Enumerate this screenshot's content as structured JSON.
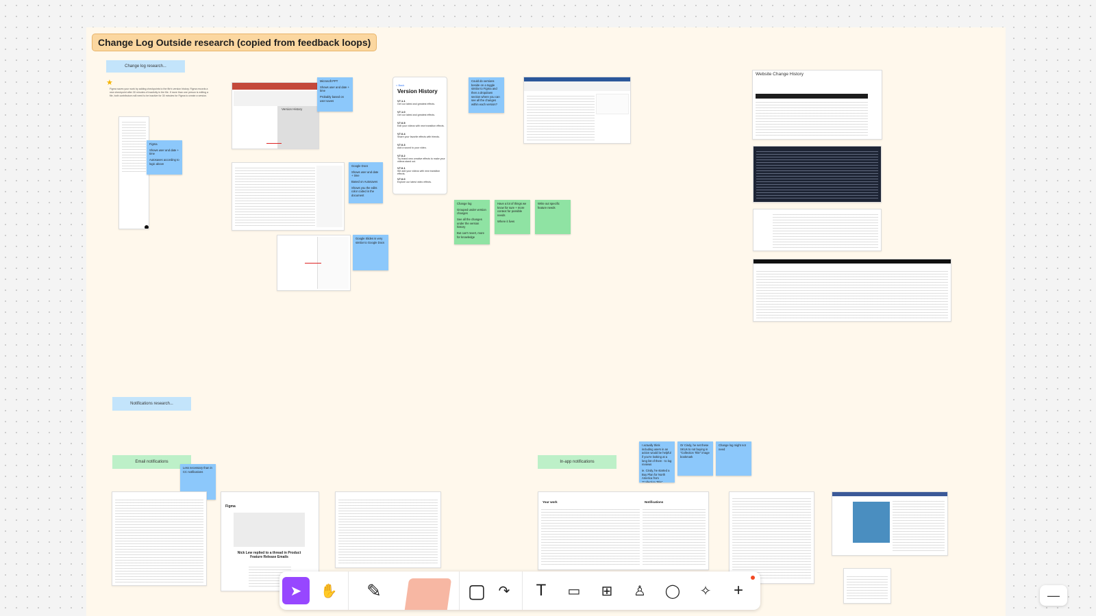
{
  "section": {
    "title": "Change Log Outside research (copied from feedback loops)"
  },
  "labels": {
    "change_log": "Change log research...",
    "notifications": "Notifications research...",
    "email": "Email notifications",
    "inapp": "In-app notifications"
  },
  "figma_note": "Figma saves your work by adding checkpoints to the file's version history. Figma records a new checkpoint after 30 minutes of inactivity in the file. If more than one person is editing a file, both contributors will need to be inactive for 30 minutes for Figma to create a version.",
  "stickies": {
    "microsoft": [
      "Microsoft PPT",
      "Shows user and date + time",
      "Probably based on user saves"
    ],
    "figma": [
      "Figma",
      "Shows user and date + time",
      "Autosaves according to logic above"
    ],
    "google_docs": [
      "Google Docs",
      "Shows user and date + time",
      "Based on Autosaves",
      "Shows you the edits color coded in the document"
    ],
    "google_slides": [
      "Google Slides is very similar to Google Docs"
    ],
    "versions_beside": [
      "Could do versions beside on a toggle similar to Figma and then a dropdown section where you can see all the changes within each version?"
    ],
    "change_log_green": [
      "Change log",
      "Grouped under version changes",
      "See all the changes under the version history",
      "But can't revert, more for knowledge"
    ],
    "tags_green": [
      "Have a lot of things we know for sure + more context for possible needs",
      "Where it lives"
    ],
    "feature_green": [
      "Write out specific feature needs"
    ],
    "less_necessary": [
      "Less necessary than in CC notifications"
    ],
    "inapp_1": [
      "I actually think including users in an action would be helpful if you're looking at a long list of them - to log reviews",
      "ie. Cindy, he started a Buy Plan for North America from \"Collection Title\""
    ],
    "inapp_2": [
      "Or Cindy, he set these SKUs to not buying in \"Collection Title\" image bookmark"
    ],
    "inapp_3": [
      "Change log might not need"
    ]
  },
  "version_history": {
    "title": "Version History",
    "back": "< Back",
    "entries": [
      {
        "version": "V7.1.1",
        "text": "Get our latest and greatest effects."
      },
      {
        "version": "V7.1.0",
        "text": "Get our latest and greatest effects."
      },
      {
        "version": "V7.0.5",
        "text": "Edit your videos with new transition effects."
      },
      {
        "version": "V7.0.4",
        "text": "Share your favorite effects with friends."
      },
      {
        "version": "V7.0.3",
        "text": "Add a sound to your video."
      },
      {
        "version": "V7.0.2",
        "text": "Try brand new creative effects to make your videos stand out."
      },
      {
        "version": "V7.0.1",
        "text": "We add your videos with new transition effects."
      },
      {
        "version": "V7.0.0",
        "text": "Explore our latest video effects."
      }
    ]
  },
  "ppt_panel": "Version History",
  "website_history": {
    "title": "Website Change History"
  },
  "email_shot": {
    "name_line": "Nick Lew replied to a thread in Product Feature Release Emails",
    "brand": "Figma"
  },
  "notif_panel": {
    "header": "Notifications",
    "work": "Your work"
  },
  "toolbar": {
    "tools": [
      {
        "name": "move-tool",
        "glyph": "➤"
      },
      {
        "name": "hand-tool",
        "glyph": "✋"
      },
      {
        "name": "marker-tool",
        "glyph": "✎"
      },
      {
        "name": "highlighter-tool",
        "glyph": ""
      },
      {
        "name": "shape-tool",
        "glyph": "▢"
      },
      {
        "name": "connector-tool",
        "glyph": "↷"
      },
      {
        "name": "text-tool",
        "glyph": "T"
      },
      {
        "name": "section-tool",
        "glyph": "▭"
      },
      {
        "name": "table-tool",
        "glyph": "⊞"
      },
      {
        "name": "stamp-tool",
        "glyph": "♙"
      },
      {
        "name": "comment-tool",
        "glyph": "◯"
      },
      {
        "name": "ai-tool",
        "glyph": "✧"
      },
      {
        "name": "more-tool",
        "glyph": "+"
      }
    ],
    "zoom_out": "—"
  },
  "colors": {
    "accent": "#9747ff",
    "section_bg": "#fff8ec",
    "sticky_blue": "#8cc8fb",
    "sticky_green": "#8fe3a3"
  }
}
